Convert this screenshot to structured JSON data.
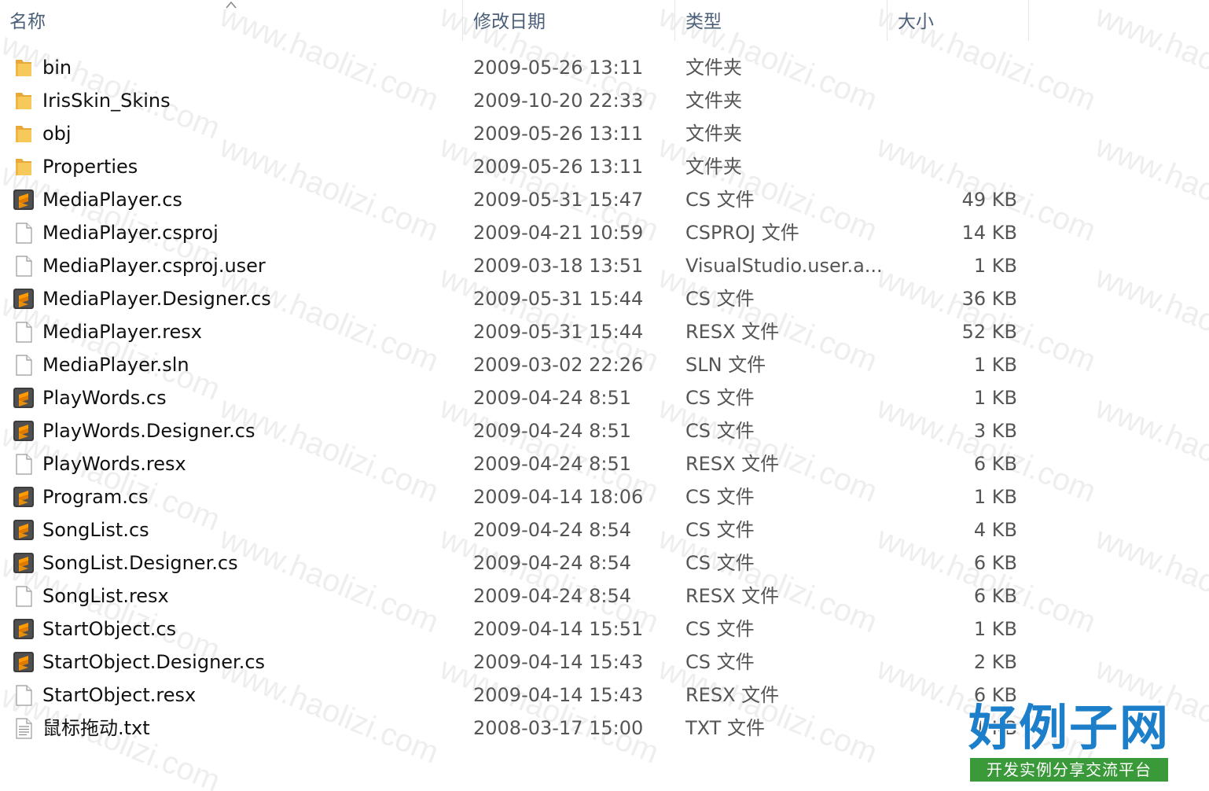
{
  "columns": {
    "name": "名称",
    "date": "修改日期",
    "type": "类型",
    "size": "大小"
  },
  "files": [
    {
      "name": "bin",
      "date": "2009-05-26 13:11",
      "type": "文件夹",
      "size": "",
      "icon": "folder-icon"
    },
    {
      "name": "IrisSkin_Skins",
      "date": "2009-10-20 22:33",
      "type": "文件夹",
      "size": "",
      "icon": "folder-icon"
    },
    {
      "name": "obj",
      "date": "2009-05-26 13:11",
      "type": "文件夹",
      "size": "",
      "icon": "folder-icon"
    },
    {
      "name": "Properties",
      "date": "2009-05-26 13:11",
      "type": "文件夹",
      "size": "",
      "icon": "folder-icon"
    },
    {
      "name": "MediaPlayer.cs",
      "date": "2009-05-31 15:47",
      "type": "CS 文件",
      "size": "49 KB",
      "icon": "sublime-file-icon"
    },
    {
      "name": "MediaPlayer.csproj",
      "date": "2009-04-21 10:59",
      "type": "CSPROJ 文件",
      "size": "14 KB",
      "icon": "blank-file-icon"
    },
    {
      "name": "MediaPlayer.csproj.user",
      "date": "2009-03-18 13:51",
      "type": "VisualStudio.user.a...",
      "size": "1 KB",
      "icon": "blank-file-icon"
    },
    {
      "name": "MediaPlayer.Designer.cs",
      "date": "2009-05-31 15:44",
      "type": "CS 文件",
      "size": "36 KB",
      "icon": "sublime-file-icon"
    },
    {
      "name": "MediaPlayer.resx",
      "date": "2009-05-31 15:44",
      "type": "RESX 文件",
      "size": "52 KB",
      "icon": "blank-file-icon"
    },
    {
      "name": "MediaPlayer.sln",
      "date": "2009-03-02 22:26",
      "type": "SLN 文件",
      "size": "1 KB",
      "icon": "blank-file-icon"
    },
    {
      "name": "PlayWords.cs",
      "date": "2009-04-24 8:51",
      "type": "CS 文件",
      "size": "1 KB",
      "icon": "sublime-file-icon"
    },
    {
      "name": "PlayWords.Designer.cs",
      "date": "2009-04-24 8:51",
      "type": "CS 文件",
      "size": "3 KB",
      "icon": "sublime-file-icon"
    },
    {
      "name": "PlayWords.resx",
      "date": "2009-04-24 8:51",
      "type": "RESX 文件",
      "size": "6 KB",
      "icon": "blank-file-icon"
    },
    {
      "name": "Program.cs",
      "date": "2009-04-14 18:06",
      "type": "CS 文件",
      "size": "1 KB",
      "icon": "sublime-file-icon"
    },
    {
      "name": "SongList.cs",
      "date": "2009-04-24 8:54",
      "type": "CS 文件",
      "size": "4 KB",
      "icon": "sublime-file-icon"
    },
    {
      "name": "SongList.Designer.cs",
      "date": "2009-04-24 8:54",
      "type": "CS 文件",
      "size": "6 KB",
      "icon": "sublime-file-icon"
    },
    {
      "name": "SongList.resx",
      "date": "2009-04-24 8:54",
      "type": "RESX 文件",
      "size": "6 KB",
      "icon": "blank-file-icon"
    },
    {
      "name": "StartObject.cs",
      "date": "2009-04-14 15:51",
      "type": "CS 文件",
      "size": "1 KB",
      "icon": "sublime-file-icon"
    },
    {
      "name": "StartObject.Designer.cs",
      "date": "2009-04-14 15:43",
      "type": "CS 文件",
      "size": "2 KB",
      "icon": "sublime-file-icon"
    },
    {
      "name": "StartObject.resx",
      "date": "2009-04-14 15:43",
      "type": "RESX 文件",
      "size": "6 KB",
      "icon": "blank-file-icon"
    },
    {
      "name": "鼠标拖动.txt",
      "date": "2008-03-17 15:00",
      "type": "TXT 文件",
      "size": "1 KB",
      "icon": "text-file-icon"
    }
  ],
  "watermark": "www.haolizi.com",
  "logo": {
    "title": "好例子网",
    "subtitle": "开发实例分享交流平台"
  },
  "colors": {
    "header_text": "#4c607a",
    "folder": "#f5c453",
    "logo_blue": "#1d7fc9",
    "logo_green": "#3a9a3a"
  }
}
